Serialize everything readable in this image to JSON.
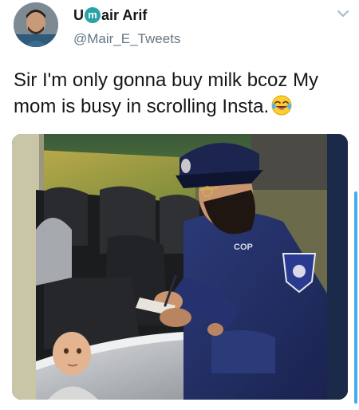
{
  "tweet": {
    "author": {
      "display_name_prefix": "U",
      "display_name_badge": "m",
      "display_name_suffix": "air Arif",
      "handle": "@Mair_E_Tweets"
    },
    "text": "Sir I'm only gonna buy milk bcoz My mom is busy in scrolling Insta.",
    "emoji": "face-with-tears-of-joy-icon",
    "media": {
      "uniform_text": "COP"
    }
  },
  "colors": {
    "text": "#14171a",
    "secondary": "#657786",
    "accent": "#1da1f2"
  }
}
